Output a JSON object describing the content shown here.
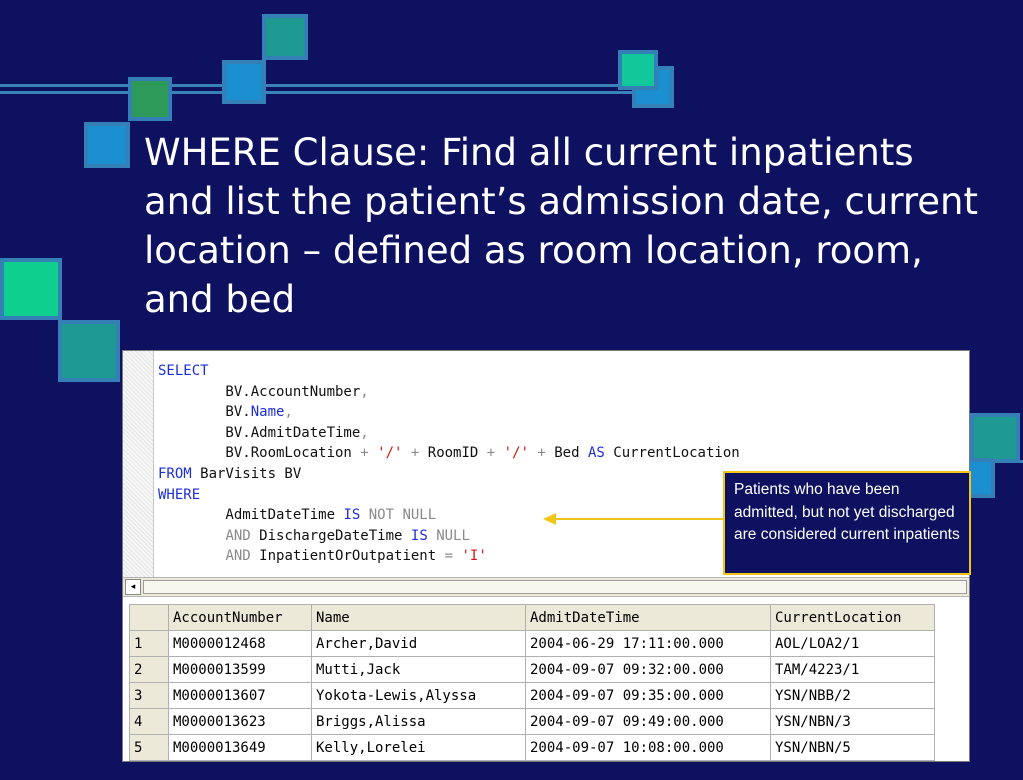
{
  "title": "WHERE Clause: Find all current inpatients and list the patient’s admission date, current location – defined as room location, room, and bed",
  "colors": {
    "background": "#0d1160",
    "square_border": "#3480b6",
    "callout_border": "#f0c419",
    "keyword": "#1d2ed8",
    "string": "#d61212"
  },
  "sql": {
    "lines": [
      [
        {
          "t": "SELECT",
          "c": "kw"
        }
      ],
      [
        {
          "t": "        BV.AccountNumber"
        },
        {
          "t": ",",
          "c": "gr"
        }
      ],
      [
        {
          "t": "        BV."
        },
        {
          "t": "Name",
          "c": "kw"
        },
        {
          "t": ",",
          "c": "gr"
        }
      ],
      [
        {
          "t": "        BV.AdmitDateTime"
        },
        {
          "t": ",",
          "c": "gr"
        }
      ],
      [
        {
          "t": "        BV.RoomLocation "
        },
        {
          "t": "+",
          "c": "gr"
        },
        {
          "t": " "
        },
        {
          "t": "'/'",
          "c": "str"
        },
        {
          "t": " "
        },
        {
          "t": "+",
          "c": "gr"
        },
        {
          "t": " RoomID "
        },
        {
          "t": "+",
          "c": "gr"
        },
        {
          "t": " "
        },
        {
          "t": "'/'",
          "c": "str"
        },
        {
          "t": " "
        },
        {
          "t": "+",
          "c": "gr"
        },
        {
          "t": " Bed "
        },
        {
          "t": "AS",
          "c": "kw"
        },
        {
          "t": " CurrentLocation"
        }
      ],
      [
        {
          "t": "FROM",
          "c": "kw"
        },
        {
          "t": " BarVisits BV"
        }
      ],
      [
        {
          "t": "WHERE",
          "c": "kw"
        }
      ],
      [
        {
          "t": "        AdmitDateTime "
        },
        {
          "t": "IS",
          "c": "kw"
        },
        {
          "t": " "
        },
        {
          "t": "NOT NULL",
          "c": "gr"
        }
      ],
      [
        {
          "t": "        "
        },
        {
          "t": "AND",
          "c": "gr"
        },
        {
          "t": " DischargeDateTime "
        },
        {
          "t": "IS",
          "c": "kw"
        },
        {
          "t": " "
        },
        {
          "t": "NULL",
          "c": "gr"
        }
      ],
      [
        {
          "t": "        "
        },
        {
          "t": "AND",
          "c": "gr"
        },
        {
          "t": " InpatientOrOutpatient "
        },
        {
          "t": "=",
          "c": "gr"
        },
        {
          "t": " "
        },
        {
          "t": "'I'",
          "c": "str"
        }
      ]
    ]
  },
  "scrollbar": {
    "left_arrow": "◂"
  },
  "results": {
    "columns": [
      "",
      "AccountNumber",
      "Name",
      "AdmitDateTime",
      "CurrentLocation"
    ],
    "rows": [
      [
        "1",
        "M0000012468",
        "Archer,David",
        "2004-06-29 17:11:00.000",
        "AOL/LOA2/1"
      ],
      [
        "2",
        "M0000013599",
        "Mutti,Jack",
        "2004-09-07 09:32:00.000",
        "TAM/4223/1"
      ],
      [
        "3",
        "M0000013607",
        "Yokota-Lewis,Alyssa",
        "2004-09-07 09:35:00.000",
        "YSN/NBB/2"
      ],
      [
        "4",
        "M0000013623",
        "Briggs,Alissa",
        "2004-09-07 09:49:00.000",
        "YSN/NBN/3"
      ],
      [
        "5",
        "M0000013649",
        "Kelly,Lorelei",
        "2004-09-07 10:08:00.000",
        "YSN/NBN/5"
      ]
    ]
  },
  "callout": {
    "text": "Patients who have been admitted, but not yet discharged are considered current inpatients"
  }
}
